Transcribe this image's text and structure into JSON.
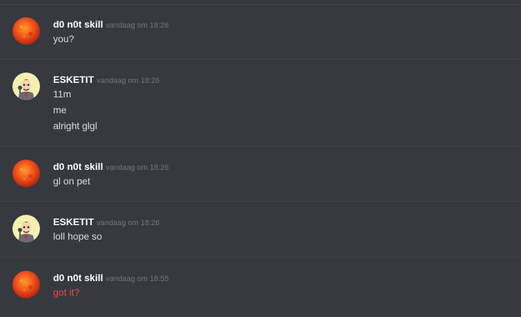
{
  "colors": {
    "background": "#36393f",
    "divider": "#42454a",
    "username": "#ffffff",
    "timestamp": "#72767d",
    "message_text": "#dcddde",
    "highlight_text": "#f04747"
  },
  "messages": [
    {
      "avatar_icon": "sun-avatar-icon",
      "username": "d0 n0t skill",
      "timestamp": "vandaag om 18:26",
      "lines": [
        "you?"
      ]
    },
    {
      "avatar_icon": "cartoon-reporter-avatar-icon",
      "username": "ESKETIT",
      "timestamp": "vandaag om 18:26",
      "lines": [
        "11m",
        "me",
        "alright glgl"
      ]
    },
    {
      "avatar_icon": "sun-avatar-icon",
      "username": "d0 n0t skill",
      "timestamp": "vandaag om 18:26",
      "lines": [
        "gl on pet"
      ]
    },
    {
      "avatar_icon": "cartoon-reporter-avatar-icon",
      "username": "ESKETIT",
      "timestamp": "vandaag om 18:26",
      "lines": [
        "loll hope so"
      ]
    },
    {
      "avatar_icon": "sun-avatar-icon",
      "username": "d0 n0t skill",
      "timestamp": "vandaag om 18:55",
      "lines": [
        "got it?"
      ]
    }
  ]
}
